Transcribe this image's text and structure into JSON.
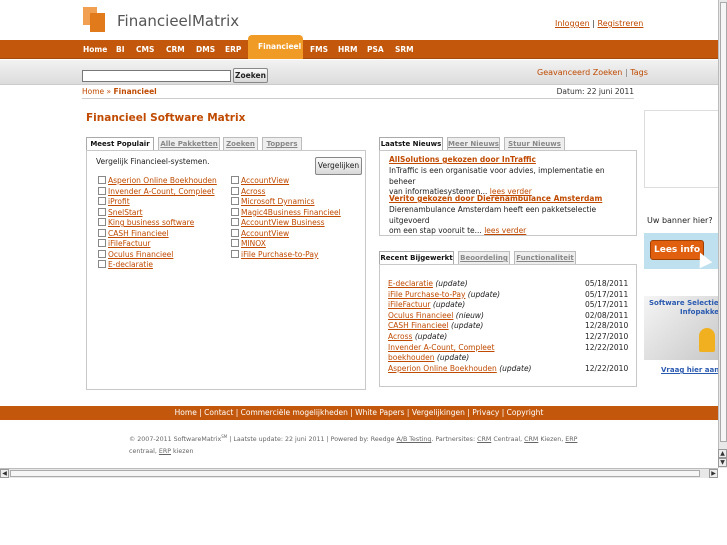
{
  "header": {
    "logo_text": "FinancieelMatrix",
    "login": "Inloggen",
    "sep": "|",
    "register": "Registreren"
  },
  "nav": {
    "items": [
      "Home",
      "BI",
      "CMS",
      "CRM",
      "DMS",
      "ERP",
      "Financieel",
      "FMS",
      "HRM",
      "PSA",
      "SRM"
    ],
    "active": "Financieel"
  },
  "search": {
    "button": "Zoeken",
    "value": "",
    "advanced": "Geavanceerd Zoeken",
    "sep": "|",
    "tags": "Tags"
  },
  "breadcrumb": {
    "home": "Home",
    "sep": "»",
    "current": "Financieel",
    "date": "Datum: 22 juni 2011"
  },
  "page_title": "Financieel Software Matrix",
  "left_tabs": [
    "Meest Populair",
    "Alle Pakketten",
    "Zoeken",
    "Toppers"
  ],
  "compare": {
    "intro": "Vergelijk Financieel-systemen.",
    "button": "Vergelijken",
    "col1": [
      "Asperion Online Boekhouden",
      "Invender A-Count, Compleet",
      "iProfit",
      "SnelStart",
      "King business software",
      "CASH Financieel",
      "iFileFactuur",
      "Oculus Financieel",
      "E-declaratie"
    ],
    "col2": [
      "AccountView",
      "Across",
      "Microsoft Dynamics",
      "Magic4Business Financieel",
      "AccountView Business",
      "AccountView",
      "MINOX",
      "iFile Purchase-to-Pay"
    ]
  },
  "news_tabs": [
    "Laatste Nieuws",
    "Meer Nieuws",
    "Stuur Nieuws"
  ],
  "news": [
    {
      "title": "AllSolutions gekozen door InTraffic",
      "line1": "InTraffic is een organisatie voor advies, implementatie en beheer",
      "line2": "van informatiesystemen...",
      "more": "lees verder"
    },
    {
      "title": "Verito gekozen door Dierenambulance Amsterdam",
      "line1": "Dierenambulance Amsterdam heeft een pakketselectie uitgevoerd",
      "line2": "om een stap vooruit te...",
      "more": "lees verder"
    }
  ],
  "updated_tabs": [
    "Recent Bijgewerkt",
    "Beoordeling",
    "Functionaliteit"
  ],
  "updated": [
    {
      "name": "E-declaratie",
      "suffix": "(update)",
      "date": "05/18/2011"
    },
    {
      "name": "iFile Purchase-to-Pay",
      "suffix": "(update)",
      "date": "05/17/2011"
    },
    {
      "name": "iFileFactuur",
      "suffix": "(update)",
      "date": "05/17/2011"
    },
    {
      "name": "Oculus Financieel",
      "suffix": "(nieuw)",
      "date": "02/08/2011"
    },
    {
      "name": "CASH Financieel",
      "suffix": "(update)",
      "date": "12/28/2010"
    },
    {
      "name": "Across",
      "suffix": "(update)",
      "date": "12/27/2010"
    },
    {
      "name": "Invender A-Count, Compleet",
      "suffix": "",
      "date": "12/22/2010"
    },
    {
      "name": "boekhouden",
      "suffix": "(update)",
      "date": ""
    },
    {
      "name": "Asperion Online Boekhouden",
      "suffix": "(update)",
      "date": "12/22/2010"
    }
  ],
  "ads": {
    "banner_q": "Uw banner hier?",
    "banner_btn": "Lees info",
    "promo_title": "Software Selectie",
    "promo_sub": "Infopakket",
    "promo_link": "Vraag hier aan"
  },
  "footer": {
    "links": [
      "Home",
      "Contact",
      "Commerciële mogelijkheden",
      "White Papers",
      "Vergelijkingen",
      "Privacy",
      "Copyright"
    ],
    "sep": "|"
  },
  "copyright": {
    "text1": "© 2007-2011 SoftwareMatrix",
    "sm": "SM",
    "text2": " | Laatste update: 22 juni 2011 | Powered by: Reedge",
    "ab": "A/B Testing",
    "text3": ". Partnersites:",
    "crm": "CRM",
    "text4": " Centraal, ",
    "crm2": "CRM",
    "text5": " Kiezen, ",
    "erp": "ERP",
    "text6": "centraal, ",
    "erp2": "ERP",
    "text7": " kiezen"
  },
  "colors": {
    "orange_nav": "#c3580c",
    "active_tab": "#f19b27",
    "link": "#c04a00"
  }
}
